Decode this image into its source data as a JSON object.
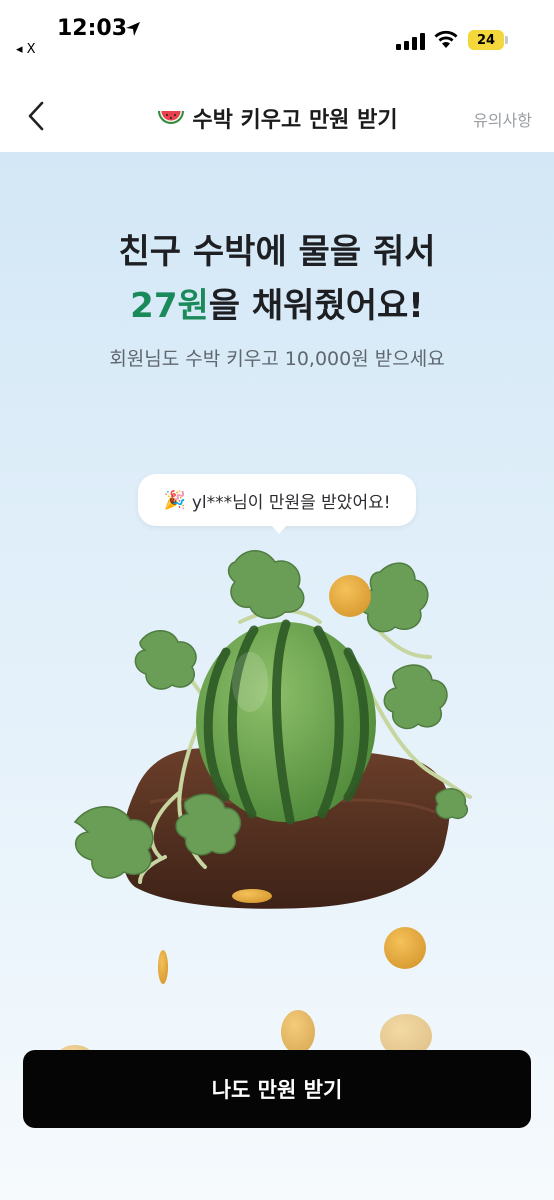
{
  "status_bar": {
    "time": "12:03",
    "back_app": "◂ X",
    "battery": "24"
  },
  "nav": {
    "title": "수박 키우고 만원 받기",
    "notice": "유의사항"
  },
  "hero": {
    "headline_line1": "친구 수박에 물을 줘서",
    "headline_amount": "27원",
    "headline_line2_rest": "을 채워줬어요!",
    "subtitle": "회원님도 수박 키우고 10,000원 받으세요"
  },
  "bubble": {
    "text": "yl***님이 만원을 받았어요!"
  },
  "cta": {
    "label": "나도 만원 받기"
  },
  "colors": {
    "accent_green": "#1b8a5a",
    "cta_bg": "#050505",
    "battery": "#f4d73b"
  }
}
